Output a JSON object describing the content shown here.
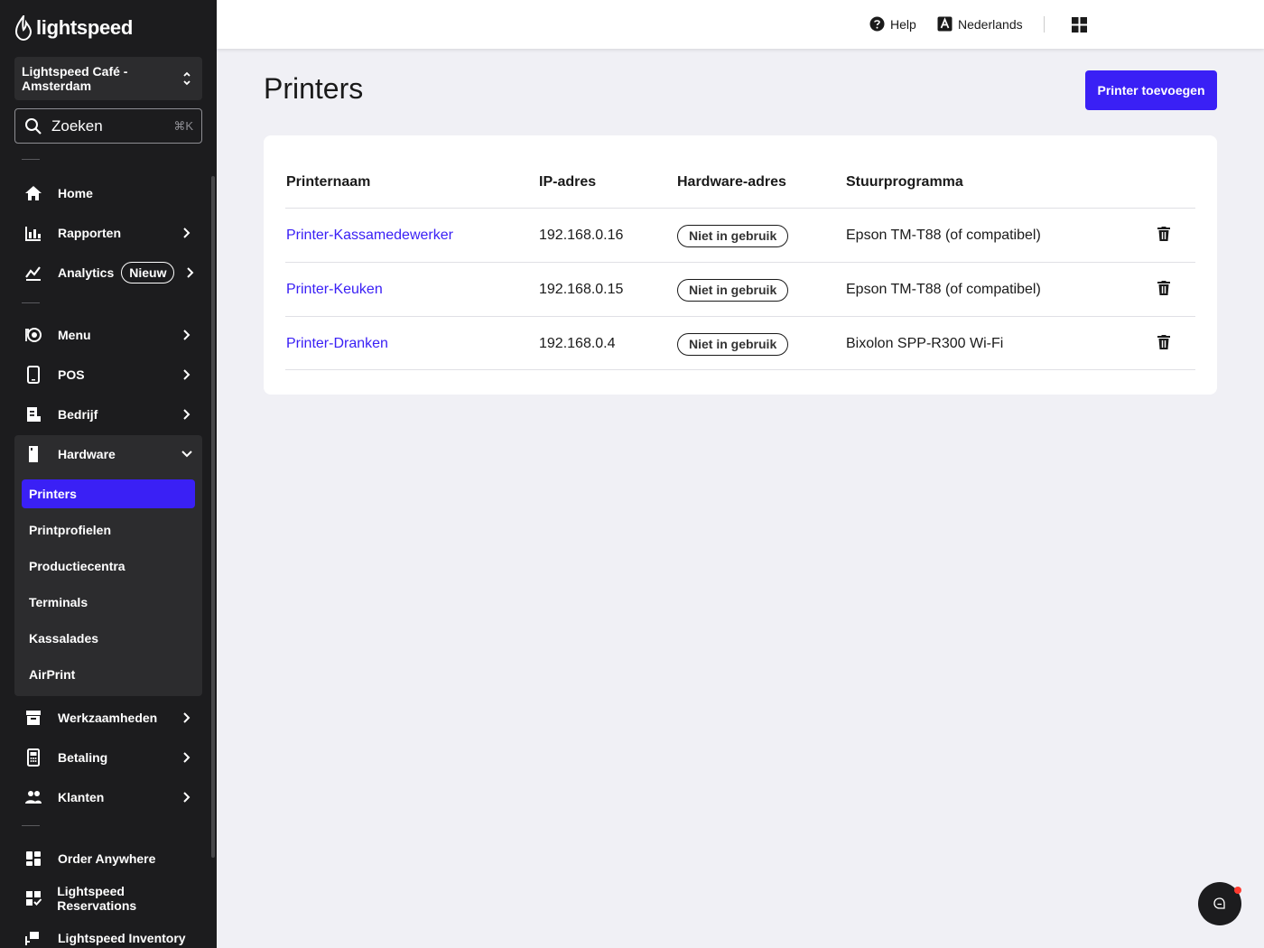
{
  "brand": {
    "name": "lightspeed"
  },
  "sidebar": {
    "store": "Lightspeed Café - Amsterdam",
    "search": {
      "label": "Zoeken",
      "shortcut": "⌘K"
    },
    "items": [
      {
        "label": "Home",
        "icon": "home-icon"
      },
      {
        "label": "Rapporten",
        "icon": "bar-chart-icon"
      },
      {
        "label": "Analytics",
        "icon": "analytics-icon",
        "badge": "Nieuw"
      },
      {
        "label": "Menu",
        "icon": "menu-plate-icon"
      },
      {
        "label": "POS",
        "icon": "tablet-icon"
      },
      {
        "label": "Bedrijf",
        "icon": "business-icon"
      },
      {
        "label": "Hardware",
        "icon": "hardware-icon"
      },
      {
        "label": "Werkzaamheden",
        "icon": "archive-icon"
      },
      {
        "label": "Betaling",
        "icon": "payment-terminal-icon"
      },
      {
        "label": "Klanten",
        "icon": "customers-icon"
      },
      {
        "label": "Order Anywhere",
        "icon": "order-anywhere-icon"
      },
      {
        "label": "Lightspeed Reservations",
        "icon": "reservations-icon"
      },
      {
        "label": "Lightspeed Inventory",
        "icon": "inventory-icon"
      }
    ],
    "hardware_sub": [
      "Printers",
      "Printprofielen",
      "Productiecentra",
      "Terminals",
      "Kassalades",
      "AirPrint"
    ],
    "active_sub": "Printers"
  },
  "topbar": {
    "help": "Help",
    "language": "Nederlands"
  },
  "page": {
    "title": "Printers",
    "add_button": "Printer toevoegen"
  },
  "table": {
    "headers": [
      "Printernaam",
      "IP-adres",
      "Hardware-adres",
      "Stuurprogramma"
    ],
    "rows": [
      {
        "name": "Printer-Kassamedewerker",
        "ip": "192.168.0.16",
        "hardware": "Niet in gebruik",
        "driver": "Epson TM-T88 (of compatibel)"
      },
      {
        "name": "Printer-Keuken",
        "ip": "192.168.0.15",
        "hardware": "Niet in gebruik",
        "driver": "Epson TM-T88 (of compatibel)"
      },
      {
        "name": "Printer-Dranken",
        "ip": "192.168.0.4",
        "hardware": "Niet in gebruik",
        "driver": "Bixolon SPP-R300 Wi-Fi"
      }
    ]
  },
  "colors": {
    "accent": "#3a20f5",
    "sidebar_bg": "#1c1c1e",
    "page_bg": "#f0f0f5",
    "notification": "#ff3b30"
  }
}
